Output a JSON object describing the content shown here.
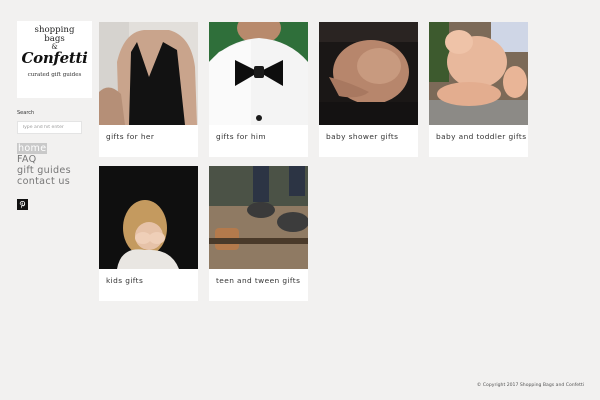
{
  "logo": {
    "line1": "shopping",
    "line2": "bags",
    "amp": "&",
    "line3": "Confetti",
    "tagline": "curated gift guides"
  },
  "search": {
    "label": "Search",
    "placeholder": "Type and hit enter"
  },
  "nav": [
    {
      "label": "home",
      "active": true
    },
    {
      "label": "FAQ",
      "active": false
    },
    {
      "label": "gift guides",
      "active": false
    },
    {
      "label": "contact us",
      "active": false
    }
  ],
  "social": {
    "pinterest_icon": "pinterest-icon"
  },
  "tiles": [
    {
      "caption": "gifts for her",
      "image": "woman-black-top"
    },
    {
      "caption": "gifts for him",
      "image": "man-bow-tie"
    },
    {
      "caption": "baby shower gifts",
      "image": "pregnant-belly"
    },
    {
      "caption": "baby and toddler gifts",
      "image": "baby-feet"
    },
    {
      "caption": "kids gifts",
      "image": "child-hiding-face"
    },
    {
      "caption": "teen and tween gifts",
      "image": "skateboard-sneakers"
    }
  ],
  "footer": {
    "copyright": "© Copyright 2017 Shopping Bags and Confetti"
  },
  "colors": {
    "background": "#f2f1f0",
    "tile": "#ffffff",
    "nav_active_bg": "#c9c9c9"
  }
}
